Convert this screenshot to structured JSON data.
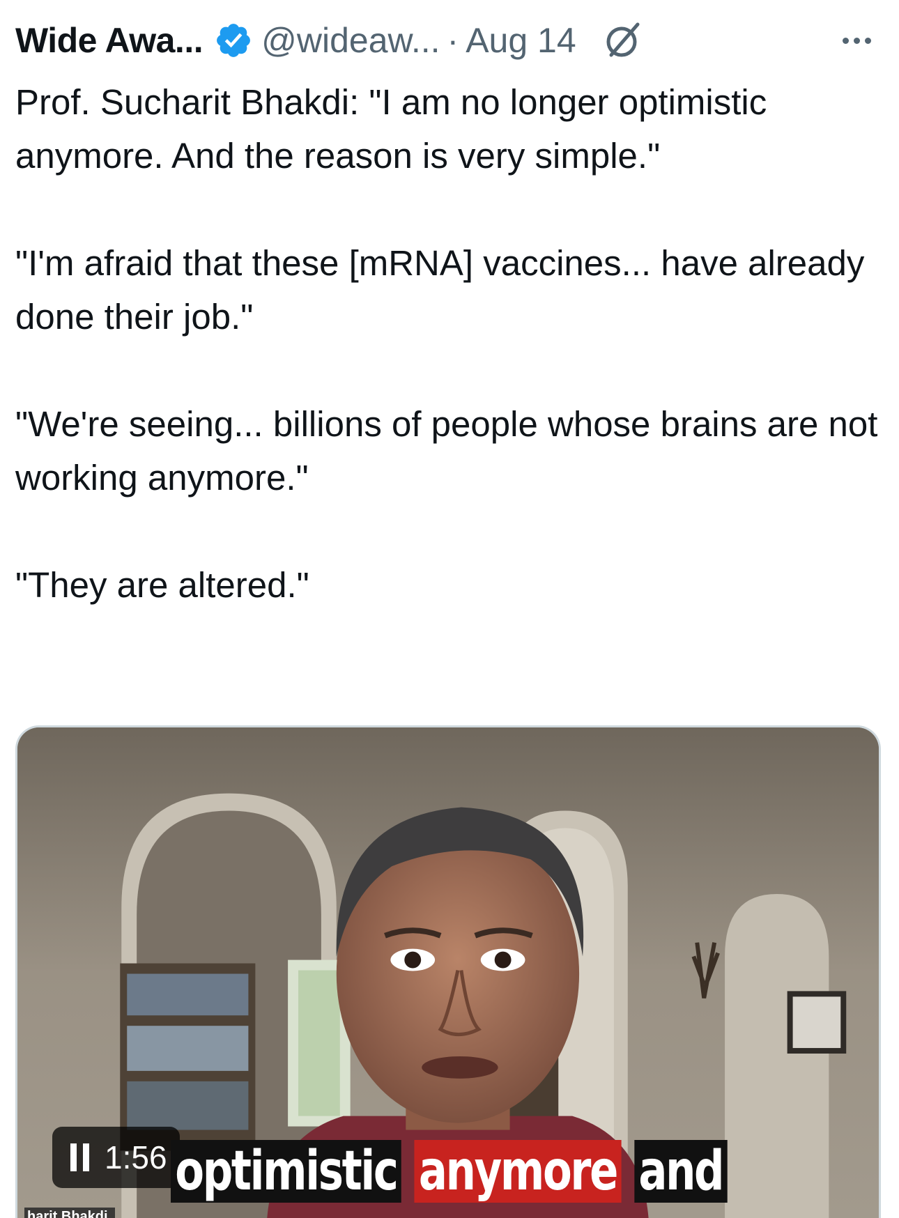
{
  "post": {
    "display_name": "Wide Awa...",
    "handle": "@wideaw...",
    "separator": "·",
    "date": "Aug 14",
    "paragraphs": [
      "Prof. Sucharit Bhakdi: \"I am no longer optimistic anymore. And the reason is very simple.\"",
      "\"I'm afraid that these [mRNA] vaccines... have already done their job.\"",
      "\"We're seeing... billions of people whose brains are not working anymore.\"",
      "\"They are altered.\""
    ]
  },
  "icons": {
    "verified": "verified-badge-icon",
    "grok": "grok-icon",
    "more": "more-options-icon",
    "pause": "pause-icon"
  },
  "colors": {
    "verified_blue": "#1d9bf0",
    "secondary_text": "#536471",
    "caption_highlight": "#c8231f"
  },
  "video": {
    "timestamp": "1:56",
    "caption_words": [
      "optimistic",
      "anymore",
      "and"
    ],
    "speaker_tag": "harit Bhakdi"
  }
}
